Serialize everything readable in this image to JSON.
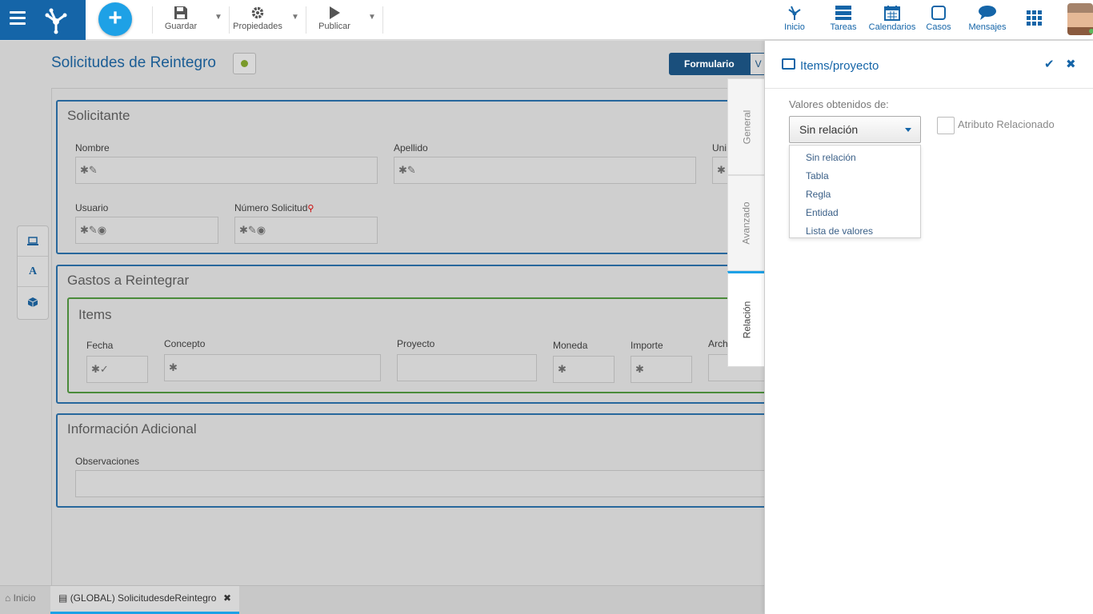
{
  "toolbar": {
    "save_label": "Guardar",
    "properties_label": "Propiedades",
    "publish_label": "Publicar"
  },
  "top_nav": {
    "items": [
      {
        "label": "Inicio",
        "icon": "process-icon"
      },
      {
        "label": "Tareas",
        "icon": "tasks-icon"
      },
      {
        "label": "Calendarios",
        "icon": "calendar-icon"
      },
      {
        "label": "Casos",
        "icon": "cases-icon"
      },
      {
        "label": "Mensajes",
        "icon": "chat-icon"
      }
    ]
  },
  "form": {
    "title": "Solicitudes de Reintegro",
    "view_tabs": [
      "Formulario",
      "V"
    ],
    "sections": {
      "solicitante": {
        "title": "Solicitante",
        "fields": {
          "nombre": "Nombre",
          "apellido": "Apellido",
          "unidad": "Uni",
          "usuario": "Usuario",
          "numero_solicitud": "Número Solicitud"
        }
      },
      "gastos": {
        "title": "Gastos a Reintegrar",
        "grid": {
          "title": "Items",
          "columns": [
            "Fecha",
            "Concepto",
            "Proyecto",
            "Moneda",
            "Importe",
            "Arch"
          ]
        }
      },
      "info": {
        "title": "Información Adicional",
        "fields": {
          "observaciones": "Observaciones"
        }
      }
    }
  },
  "bottom_tabs": {
    "home": "Inicio",
    "active_tab": "(GLOBAL) SolicitudesdeReintegro"
  },
  "panel": {
    "title": "Items/proyecto",
    "tabs": [
      "General",
      "Avanzado",
      "Relación"
    ],
    "active_tab": "Relación",
    "values_label": "Valores obtenidos de:",
    "selected": "Sin relación",
    "related_attr_label": "Atributo Relacionado",
    "options": [
      "Sin relación",
      "Tabla",
      "Regla",
      "Entidad",
      "Lista de valores"
    ]
  },
  "colors": {
    "brand": "#1565a8",
    "accent": "#1ea1e6",
    "section_border": "#27679c",
    "grid_border": "#4a8b3a"
  }
}
